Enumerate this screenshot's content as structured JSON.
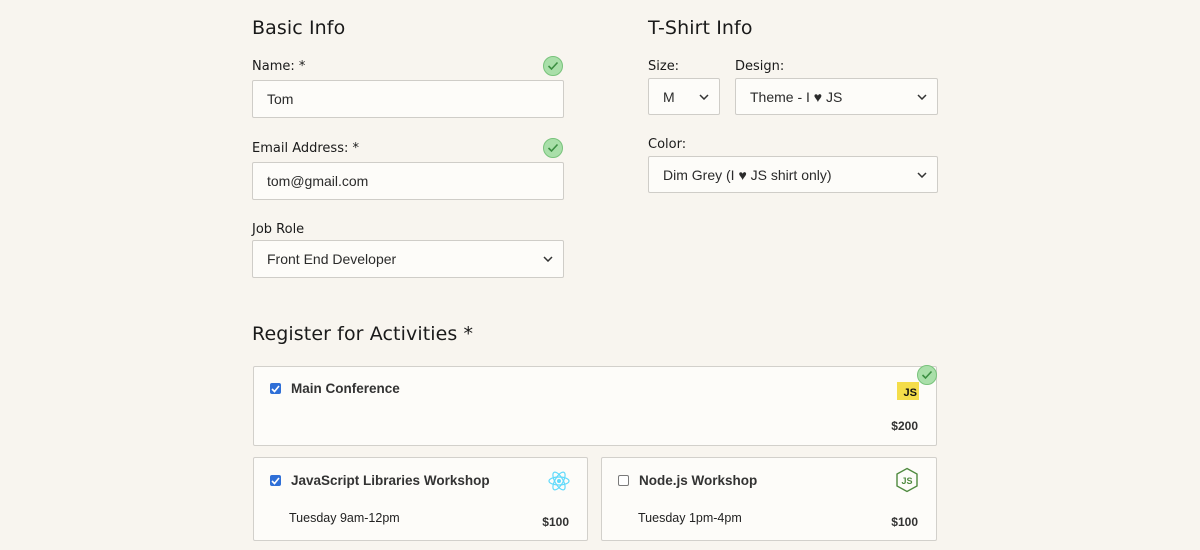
{
  "basic_info": {
    "heading": "Basic Info",
    "name": {
      "label": "Name: *",
      "value": "Tom",
      "valid": true
    },
    "email": {
      "label": "Email Address: *",
      "value": "tom@gmail.com",
      "valid": true
    },
    "job_role": {
      "label": "Job Role",
      "selected": "Front End Developer"
    }
  },
  "tshirt_info": {
    "heading": "T-Shirt Info",
    "size": {
      "label": "Size:",
      "selected": "M"
    },
    "design": {
      "label": "Design:",
      "selected": "Theme - I ♥ JS"
    },
    "color": {
      "label": "Color:",
      "selected": "Dim Grey (I ♥ JS shirt only)"
    }
  },
  "activities": {
    "heading": "Register for Activities *",
    "valid": true,
    "items": [
      {
        "name": "Main Conference",
        "time": "",
        "price": "$200",
        "checked": true,
        "icon": "javascript-icon",
        "badge_text": "JS"
      },
      {
        "name": "JavaScript Libraries Workshop",
        "time": "Tuesday 9am-12pm",
        "price": "$100",
        "checked": true,
        "icon": "react-icon"
      },
      {
        "name": "Node.js Workshop",
        "time": "Tuesday 1pm-4pm",
        "price": "$100",
        "checked": false,
        "icon": "nodejs-icon"
      }
    ]
  },
  "colors": {
    "background": "#f8f5ef",
    "valid_check": "#a9dfa9",
    "checkbox_checked": "#2f6fd7",
    "js_yellow": "#f4dd4a",
    "react_blue": "#61dafb",
    "node_green": "#4f8a3f"
  }
}
